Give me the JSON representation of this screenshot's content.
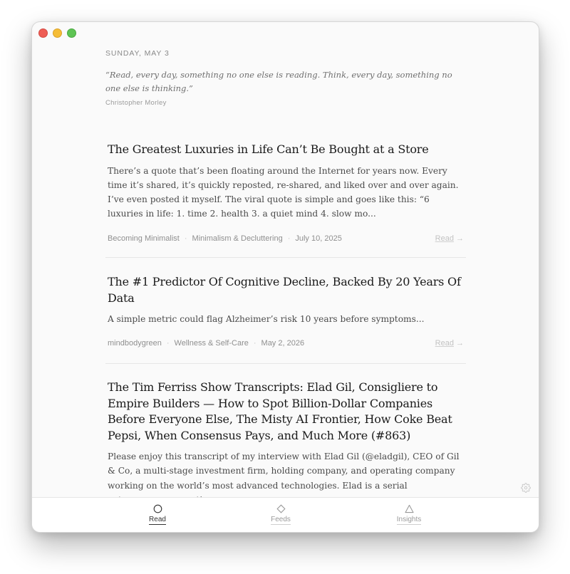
{
  "window": {
    "controls": [
      "close",
      "minimize",
      "zoom"
    ]
  },
  "header": {
    "date": "SUNDAY, MAY 3",
    "quote": "“Read, every day, something no one else is reading. Think, every day, something no one else is thinking.”",
    "author": "Christopher Morley"
  },
  "articles": [
    {
      "title": "The Greatest Luxuries in Life Can’t Be Bought at a Store",
      "excerpt": "There’s a quote that’s been floating around the Internet for years now. Every time it’s shared, it’s quickly reposted, re-shared, and liked over and over again. I’ve even posted it myself. The viral quote is simple and goes like this: “6 luxuries in life: 1. time 2. health 3. a quiet mind 4. slow mo...",
      "source": "Becoming Minimalist",
      "category": "Minimalism & Decluttering",
      "date": "July 10, 2025",
      "read_label": "Read",
      "read_arrow": "→"
    },
    {
      "title": "The #1 Predictor Of Cognitive Decline, Backed By 20 Years Of Data",
      "excerpt": "A simple metric could flag Alzheimer’s risk 10 years before symptoms...",
      "source": "mindbodygreen",
      "category": "Wellness & Self-Care",
      "date": "May 2, 2026",
      "read_label": "Read",
      "read_arrow": "→"
    },
    {
      "title": "The Tim Ferriss Show Transcripts: Elad Gil, Consigliere to Empire Builders — How to Spot Billion-Dollar Companies Before Everyone Else, The Misty AI Frontier, How Coke Beat Pepsi, When Consensus Pays, and Much More (#863)",
      "excerpt": "Please enjoy this transcript of my interview with Elad Gil (@eladgil), CEO of Gil & Co, a multi-stage investment firm, holding company, and operating company working on the world’s most advanced technologies. Elad is a serial entrepreneur, operating"
    }
  ],
  "meta_separator": "·",
  "tabs": [
    {
      "label": "Read",
      "icon": "circle-icon",
      "active": true
    },
    {
      "label": "Feeds",
      "icon": "diamond-icon",
      "active": false
    },
    {
      "label": "Insights",
      "icon": "triangle-icon",
      "active": false
    }
  ],
  "colors": {
    "window_bg": "#fafafa",
    "title": "#1a1a1a",
    "excerpt": "#4a4a4a",
    "meta": "#8f8f8f",
    "close": "#ee5d55",
    "minimize": "#f5bd37",
    "zoom": "#5fc454"
  }
}
